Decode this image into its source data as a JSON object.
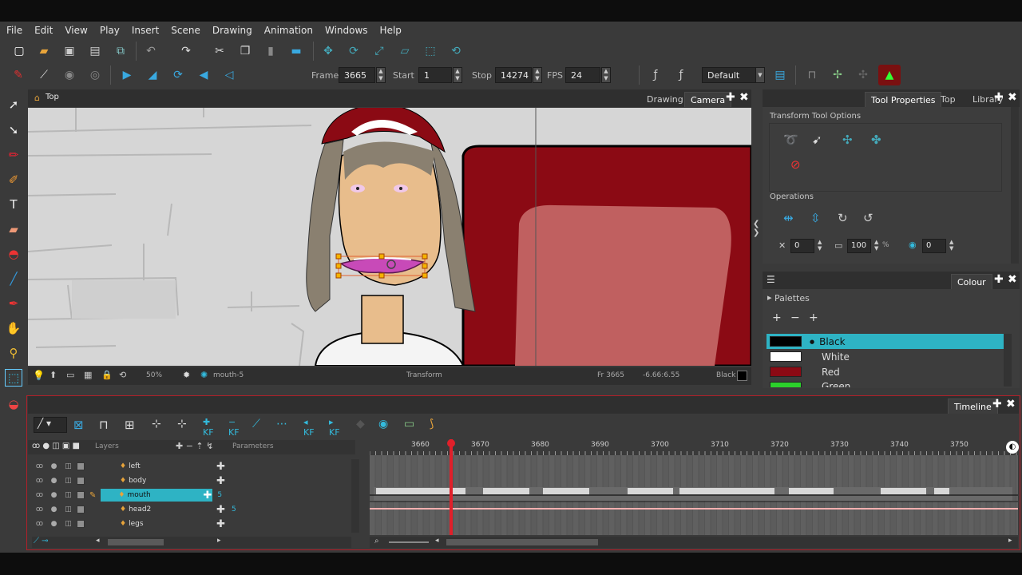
{
  "menu": [
    "File",
    "Edit",
    "View",
    "Play",
    "Insert",
    "Scene",
    "Drawing",
    "Animation",
    "Windows",
    "Help"
  ],
  "playback": {
    "frame_label": "Frame",
    "frame_value": "3665",
    "start_label": "Start",
    "start_value": "1",
    "stop_label": "Stop",
    "stop_value": "14274",
    "fps_label": "FPS",
    "fps_value": "24"
  },
  "workspace": {
    "value": "Default"
  },
  "view": {
    "breadcrumb": "Top",
    "tabs": [
      "Drawing",
      "Camera"
    ],
    "active_tab": "Camera",
    "zoom": "50%",
    "current_drawing": "mouth-5",
    "tool": "Transform",
    "frame": "Fr 3665",
    "coords": "-6.66:6.55",
    "colour": "Black"
  },
  "tool_properties": {
    "tabs": [
      "Tool Properties",
      "Top",
      "Library"
    ],
    "active_tab": "Tool Properties",
    "title": "Transform Tool Options",
    "operations_label": "Operations",
    "angle": "0",
    "scale": "100",
    "percent": "%",
    "offset": "0"
  },
  "colour_panel": {
    "tab": "Colour",
    "palettes_label": "Palettes",
    "swatches": [
      {
        "name": "Black",
        "color": "#000000",
        "selected": true
      },
      {
        "name": "White",
        "color": "#ffffff",
        "selected": false
      },
      {
        "name": "Red",
        "color": "#8b0a14",
        "selected": false
      },
      {
        "name": "Green",
        "color": "#2bd12b",
        "selected": false
      }
    ]
  },
  "timeline": {
    "tab": "Timeline",
    "layers_header": "Layers",
    "parameters_header": "Parameters",
    "layers": [
      {
        "name": "left",
        "param": "",
        "selected": false
      },
      {
        "name": "body",
        "param": "",
        "selected": false
      },
      {
        "name": "mouth",
        "param": "5",
        "selected": true
      },
      {
        "name": "head2",
        "param": "5",
        "selected": false
      },
      {
        "name": "legs",
        "param": "",
        "selected": false
      }
    ],
    "ruler_ticks": [
      "3660",
      "3670",
      "3680",
      "3690",
      "3700",
      "3710",
      "3720",
      "3730",
      "3740",
      "3750"
    ],
    "current_frame": 3665
  },
  "colors": {
    "accent": "#2eb3c4",
    "chrome": "#3a3a3a",
    "playhead": "#e0202a",
    "wall": "#d6d6d6",
    "skin": "#e8bd8c",
    "hair": "#8a8070",
    "chair": "#8b0a14",
    "chair_cushion": "#c06060"
  },
  "icons": [
    "select-arrow-icon",
    "contour-editor-icon",
    "brush-icon",
    "pencil-icon",
    "text-icon",
    "eraser-icon",
    "paint-icon",
    "line-icon",
    "dropper-icon",
    "hand-icon",
    "rigging-icon",
    "transform-icon",
    "onion-icon"
  ]
}
